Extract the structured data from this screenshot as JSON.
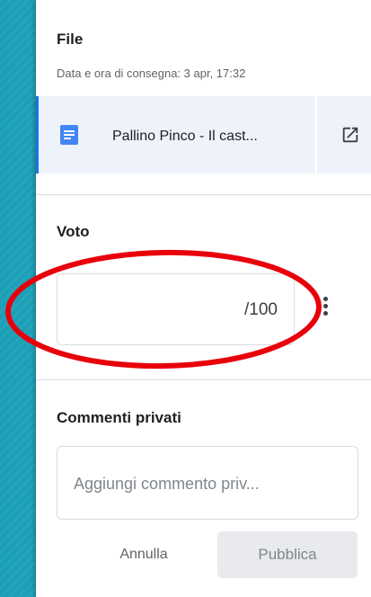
{
  "file_section": {
    "title": "File",
    "delivery_info": "Data e ora di consegna: 3 apr, 17:32",
    "attachment": {
      "name": "Pallino Pinco - Il cast...",
      "icon": "google-docs-icon",
      "open_icon": "open-in-new-icon"
    }
  },
  "grade_section": {
    "title": "Voto",
    "max_points": "/100",
    "grade_value": "",
    "more_icon": "more-vert-icon"
  },
  "comments_section": {
    "title": "Commenti privati",
    "placeholder": "Aggiungi commento priv...",
    "cancel_label": "Annulla",
    "publish_label": "Pubblica"
  },
  "annotation": {
    "shape": "ellipse",
    "color": "#e8000b",
    "target": "grade-input"
  }
}
